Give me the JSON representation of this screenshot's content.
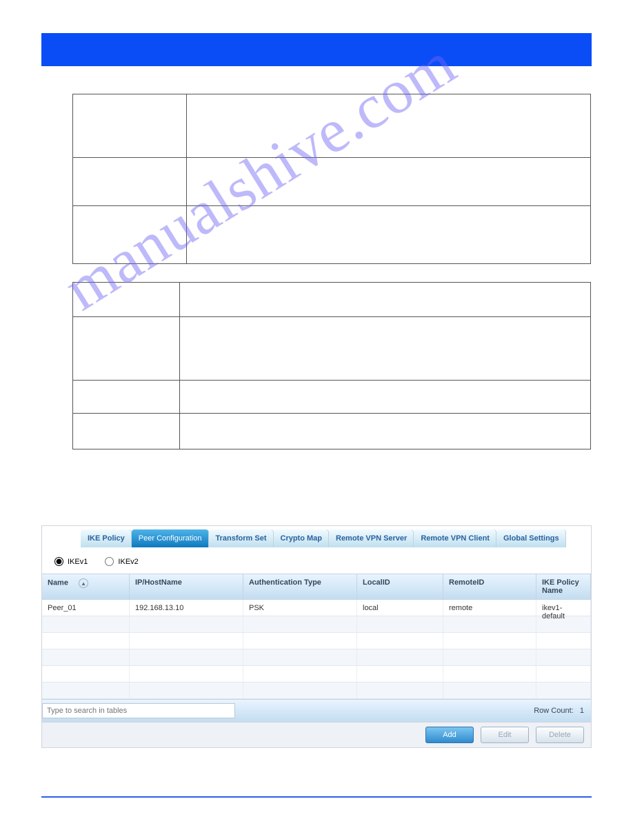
{
  "colors": {
    "brand": "#0a4df7",
    "tab_active": "#0f79bf"
  },
  "watermark": "manualshive.com",
  "tabs": [
    {
      "label": "IKE Policy"
    },
    {
      "label": "Peer Configuration",
      "active": true
    },
    {
      "label": "Transform Set"
    },
    {
      "label": "Crypto Map"
    },
    {
      "label": "Remote VPN Server"
    },
    {
      "label": "Remote VPN Client"
    },
    {
      "label": "Global Settings"
    }
  ],
  "radios": {
    "ikev1": "IKEv1",
    "ikev2": "IKEv2",
    "selected": "IKEv1"
  },
  "grid": {
    "columns": [
      "Name",
      "IP/HostName",
      "Authentication Type",
      "LocalID",
      "RemoteID",
      "IKE Policy Name"
    ],
    "rows": [
      {
        "name": "Peer_01",
        "host": "192.168.13.10",
        "auth": "PSK",
        "local": "local",
        "remote": "remote",
        "policy": "ikev1-default"
      }
    ],
    "search_placeholder": "Type to search in tables",
    "row_count_label": "Row Count:",
    "row_count": "1"
  },
  "buttons": {
    "add": "Add",
    "edit": "Edit",
    "delete": "Delete"
  }
}
